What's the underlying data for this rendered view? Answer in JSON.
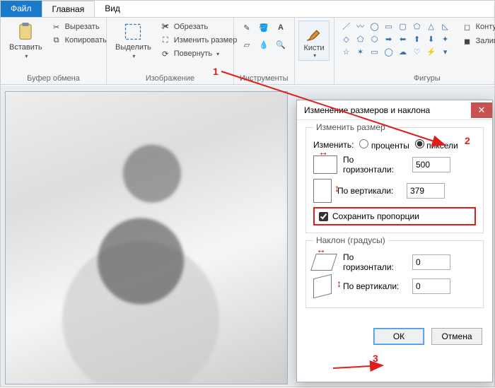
{
  "tabs": {
    "file": "Файл",
    "home": "Главная",
    "view": "Вид"
  },
  "ribbon": {
    "clipboard": {
      "title": "Буфер обмена",
      "paste": "Вставить",
      "cut": "Вырезать",
      "copy": "Копировать"
    },
    "image": {
      "title": "Изображение",
      "select": "Выделить",
      "crop": "Обрезать",
      "resize": "Изменить размер",
      "rotate": "Повернуть"
    },
    "tools": {
      "title": "Инструменты"
    },
    "brushes": {
      "label": "Кисти"
    },
    "shapes": {
      "title": "Фигуры",
      "outline": "Контур",
      "fill": "Заливка"
    }
  },
  "dialog": {
    "title": "Изменение размеров и наклона",
    "resize_legend": "Изменить размер",
    "by_label": "Изменить:",
    "percent": "проценты",
    "pixels": "пиксели",
    "horizontal": "По горизонтали:",
    "vertical": "По вертикали:",
    "h_value": "500",
    "v_value": "379",
    "keep_ratio": "Сохранить пропорции",
    "skew_legend": "Наклон (градусы)",
    "skew_h": "0",
    "skew_v": "0",
    "ok": "ОК",
    "cancel": "Отмена"
  },
  "annotations": {
    "n1": "1",
    "n2": "2",
    "n3": "3"
  }
}
